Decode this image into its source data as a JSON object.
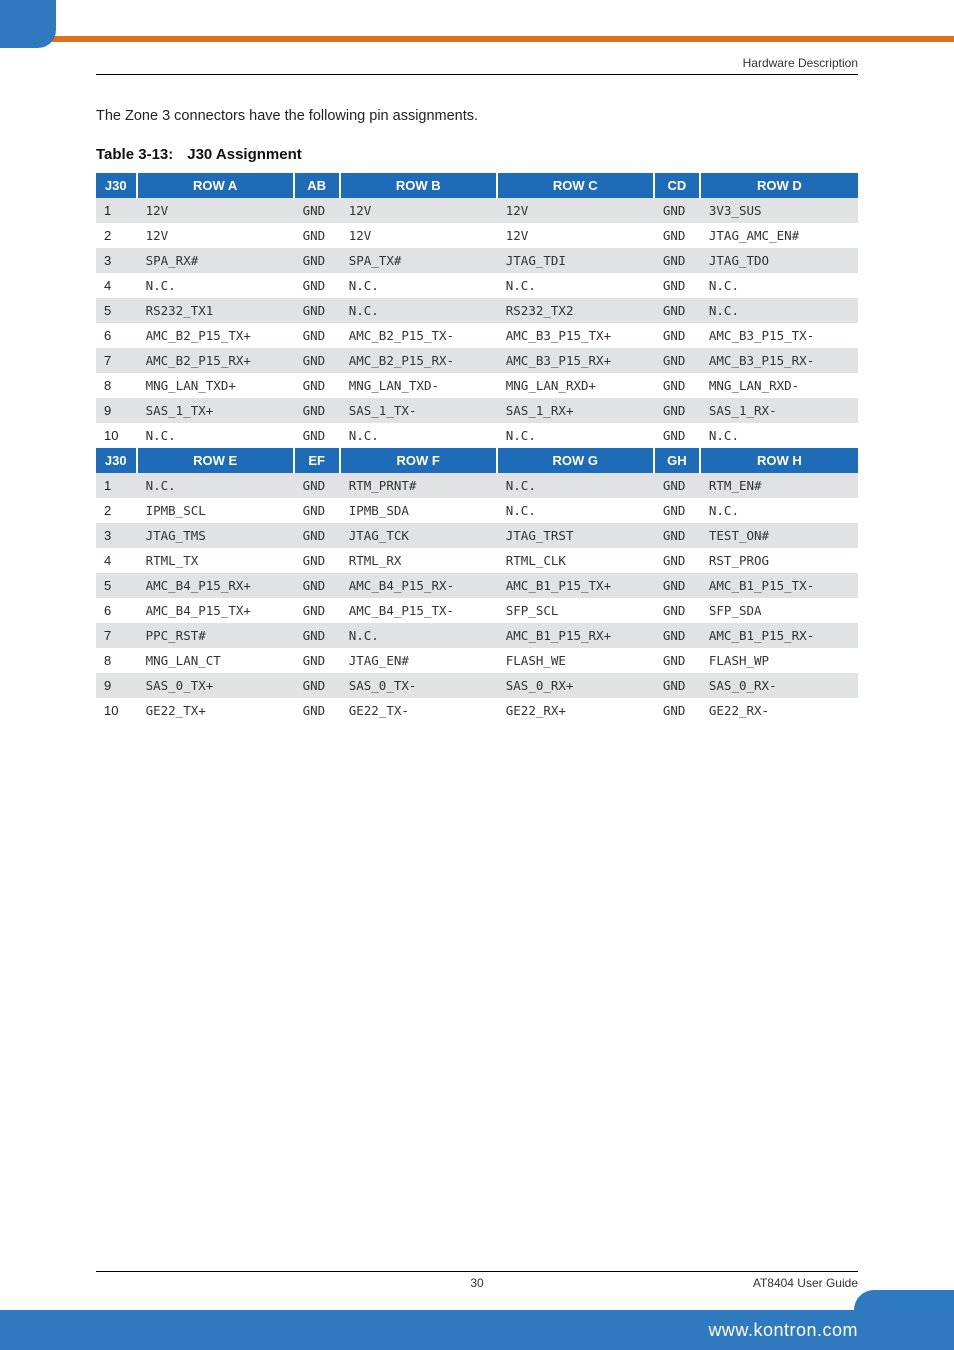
{
  "header": {
    "section": "Hardware Description"
  },
  "intro": "The Zone 3 connectors have the following pin assignments.",
  "caption": {
    "number": "Table 3-13:",
    "title": "J30 Assignment"
  },
  "footer": {
    "page": "30",
    "guide": "AT8404 User Guide",
    "url": "www.kontron.com"
  },
  "table1": {
    "headers": [
      "J30",
      "ROW A",
      "AB",
      "ROW B",
      "ROW C",
      "CD",
      "ROW D"
    ],
    "rows": [
      [
        "1",
        "12V",
        "GND",
        "12V",
        "12V",
        "GND",
        "3V3_SUS"
      ],
      [
        "2",
        "12V",
        "GND",
        "12V",
        "12V",
        "GND",
        "JTAG_AMC_EN#"
      ],
      [
        "3",
        "SPA_RX#",
        "GND",
        "SPA_TX#",
        "JTAG_TDI",
        "GND",
        "JTAG_TDO"
      ],
      [
        "4",
        "N.C.",
        "GND",
        "N.C.",
        "N.C.",
        "GND",
        "N.C."
      ],
      [
        "5",
        "RS232_TX1",
        "GND",
        "N.C.",
        "RS232_TX2",
        "GND",
        "N.C."
      ],
      [
        "6",
        "AMC_B2_P15_TX+",
        "GND",
        "AMC_B2_P15_TX-",
        "AMC_B3_P15_TX+",
        "GND",
        "AMC_B3_P15_TX-"
      ],
      [
        "7",
        "AMC_B2_P15_RX+",
        "GND",
        "AMC_B2_P15_RX-",
        "AMC_B3_P15_RX+",
        "GND",
        "AMC_B3_P15_RX-"
      ],
      [
        "8",
        "MNG_LAN_TXD+",
        "GND",
        "MNG_LAN_TXD-",
        "MNG_LAN_RXD+",
        "GND",
        "MNG_LAN_RXD-"
      ],
      [
        "9",
        "SAS_1_TX+",
        "GND",
        "SAS_1_TX-",
        "SAS_1_RX+",
        "GND",
        "SAS_1_RX-"
      ],
      [
        "10",
        "N.C.",
        "GND",
        "N.C.",
        "N.C.",
        "GND",
        "N.C."
      ]
    ]
  },
  "table2": {
    "headers": [
      "J30",
      "ROW E",
      "EF",
      "ROW F",
      "ROW G",
      "GH",
      "ROW H"
    ],
    "rows": [
      [
        "1",
        "N.C.",
        "GND",
        "RTM_PRNT#",
        "N.C.",
        "GND",
        "RTM_EN#"
      ],
      [
        "2",
        "IPMB_SCL",
        "GND",
        "IPMB_SDA",
        "N.C.",
        "GND",
        "N.C."
      ],
      [
        "3",
        "JTAG_TMS",
        "GND",
        "JTAG_TCK",
        "JTAG_TRST",
        "GND",
        "TEST_ON#"
      ],
      [
        "4",
        "RTML_TX",
        "GND",
        "RTML_RX",
        "RTML_CLK",
        "GND",
        "RST_PROG"
      ],
      [
        "5",
        "AMC_B4_P15_RX+",
        "GND",
        "AMC_B4_P15_RX-",
        "AMC_B1_P15_TX+",
        "GND",
        "AMC_B1_P15_TX-"
      ],
      [
        "6",
        "AMC_B4_P15_TX+",
        "GND",
        "AMC_B4_P15_TX-",
        "SFP_SCL",
        "GND",
        "SFP_SDA"
      ],
      [
        "7",
        "PPC_RST#",
        "GND",
        "N.C.",
        "AMC_B1_P15_RX+",
        "GND",
        "AMC_B1_P15_RX-"
      ],
      [
        "8",
        "MNG_LAN_CT",
        "GND",
        "JTAG_EN#",
        "FLASH_WE",
        "GND",
        "FLASH_WP"
      ],
      [
        "9",
        "SAS_0_TX+",
        "GND",
        "SAS_0_TX-",
        "SAS_0_RX+",
        "GND",
        "SAS_0_RX-"
      ],
      [
        "10",
        "GE22_TX+",
        "GND",
        "GE22_TX-",
        "GE22_RX+",
        "GND",
        "GE22_RX-"
      ]
    ]
  }
}
